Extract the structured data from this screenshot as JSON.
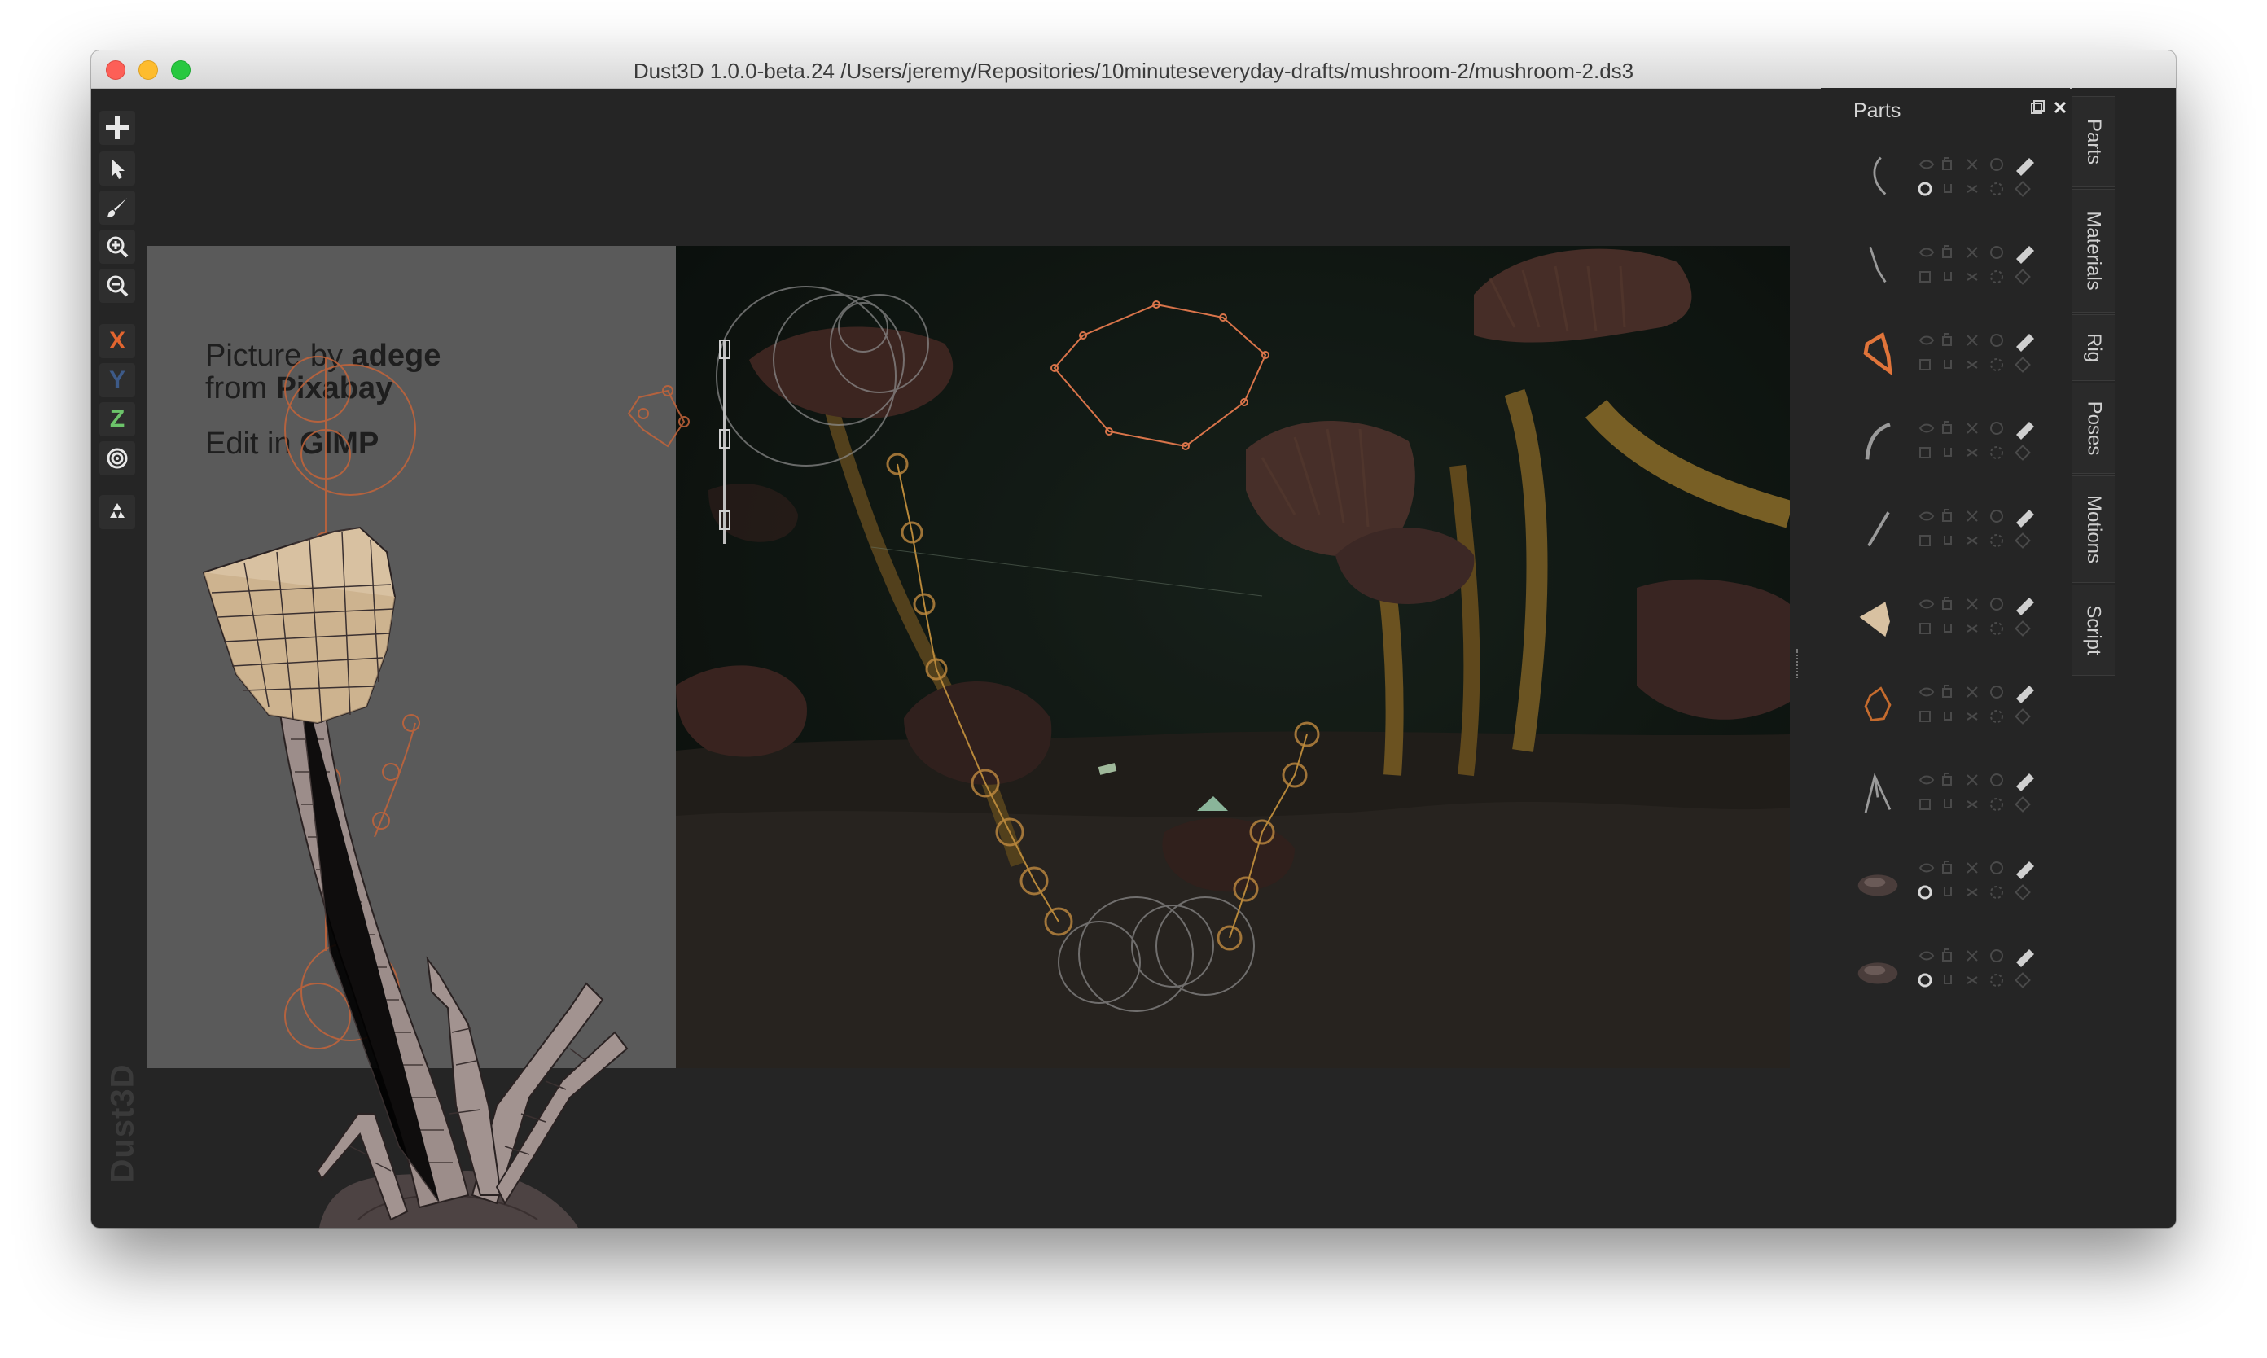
{
  "window": {
    "title": "Dust3D 1.0.0-beta.24 /Users/jeremy/Repositories/10minuteseveryday-drafts/mushroom-2/mushroom-2.ds3"
  },
  "toolbar": {
    "buttons": [
      {
        "name": "add-button",
        "icon": "plus-icon"
      },
      {
        "name": "select-button",
        "icon": "pointer-icon"
      },
      {
        "name": "paint-button",
        "icon": "brush-icon"
      },
      {
        "name": "zoom-in-button",
        "icon": "zoom-in-icon"
      },
      {
        "name": "zoom-out-button",
        "icon": "zoom-out-icon"
      },
      {
        "name": "x-axis-button",
        "label": "X",
        "color": "#e2652f"
      },
      {
        "name": "y-axis-button",
        "label": "Y",
        "color": "#3d5a88"
      },
      {
        "name": "z-axis-button",
        "label": "Z",
        "color": "#6cc36a"
      },
      {
        "name": "radius-button",
        "icon": "target-icon"
      },
      {
        "name": "regenerate-button",
        "icon": "recycle-icon"
      }
    ]
  },
  "watermark": "Dust3D",
  "reference": {
    "credit_prefix": "Picture by ",
    "credit_author": "adege",
    "credit_from": "from ",
    "credit_source": "Pixabay",
    "edit_prefix": "Edit in ",
    "edit_tool": "GIMP"
  },
  "parts_panel": {
    "title": "Parts",
    "parts": [
      {
        "shape": "stroke-curve",
        "color": "#9a9a9a",
        "selected": true
      },
      {
        "shape": "stroke-diag",
        "color": "#9a9a9a",
        "selected": false
      },
      {
        "shape": "ring-orange",
        "color": "#e0743a",
        "selected": false
      },
      {
        "shape": "stroke-arc",
        "color": "#9a9a9a",
        "selected": false
      },
      {
        "shape": "stroke-line",
        "color": "#9a9a9a",
        "selected": false
      },
      {
        "shape": "cap",
        "color": "#d8c1a1",
        "selected": false
      },
      {
        "shape": "ring-dark-orange",
        "color": "#c46b2e",
        "selected": false
      },
      {
        "shape": "fork",
        "color": "#9a9a9a",
        "selected": false
      },
      {
        "shape": "rock",
        "color": "#4a3d3b",
        "selected": true
      },
      {
        "shape": "rock",
        "color": "#4a3d3b",
        "selected": true
      }
    ]
  },
  "side_tabs": [
    "Parts",
    "Materials",
    "Rig",
    "Poses",
    "Motions",
    "Script"
  ],
  "colors": {
    "window_bg": "#252525",
    "reference_panel": "#5a5a5a",
    "node_orange": "#d9744a",
    "mesh_cap": "#d8c1a1",
    "mesh_stem": "#9c8d8a"
  }
}
